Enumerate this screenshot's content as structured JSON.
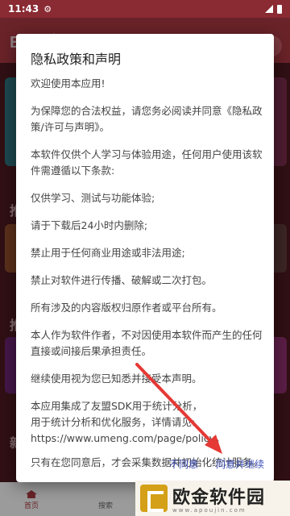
{
  "status_bar": {
    "time": "11:43"
  },
  "background_app": {
    "title": "EMO音乐",
    "section_labels": [
      "推",
      "推",
      "新"
    ],
    "nav": {
      "home": "首页",
      "search": "搜索"
    }
  },
  "dialog": {
    "title": "隐私政策和声明",
    "paragraphs": [
      "欢迎使用本应用!",
      "为保障您的合法权益，请您务必阅读并同意《隐私政策/许可与声明》。",
      "本软件仅供个人学习与体验用途，任何用户使用该软件需遵循以下条款:",
      "仅供学习、测试与功能体验;",
      "请于下载后24小时内删除;",
      "禁止用于任何商业用途或非法用途;",
      "禁止对软件进行传播、破解或二次打包。",
      "所有涉及的内容版权归原作者或平台所有。",
      "本人作为软件作者，不对因使用本软件而产生的任何直接或间接后果承担责任。",
      "继续使用视为您已知悉并接受本声明。",
      "本应用集成了友盟SDK用于统计分析，\n用于统计分析和优化服务，详情请见:\nhttps://www.umeng.com/page/policy。",
      "只有在您同意后，才会采集数据并初始化统计服务。"
    ],
    "buttons": {
      "disagree": "不同意",
      "agree": "同意并继续"
    }
  },
  "watermark": {
    "name": "欧金软件园",
    "url": "www.apoujin.com"
  },
  "colors": {
    "accent": "#a33640",
    "button": "#3f51b5",
    "arrow": "#e53935"
  }
}
